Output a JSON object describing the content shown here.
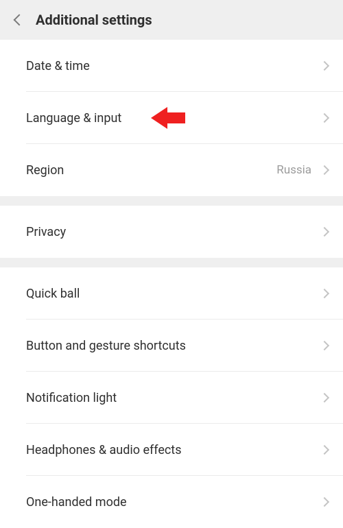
{
  "header": {
    "title": "Additional settings"
  },
  "sections": [
    {
      "rows": [
        {
          "label": "Date & time",
          "value": ""
        },
        {
          "label": "Language & input",
          "value": ""
        },
        {
          "label": "Region",
          "value": "Russia"
        }
      ]
    },
    {
      "rows": [
        {
          "label": "Privacy",
          "value": ""
        }
      ]
    },
    {
      "rows": [
        {
          "label": "Quick ball",
          "value": ""
        },
        {
          "label": "Button and gesture shortcuts",
          "value": ""
        },
        {
          "label": "Notification light",
          "value": ""
        },
        {
          "label": "Headphones & audio effects",
          "value": ""
        },
        {
          "label": "One-handed mode",
          "value": ""
        }
      ]
    }
  ],
  "annotation": {
    "color": "#ef2020"
  }
}
